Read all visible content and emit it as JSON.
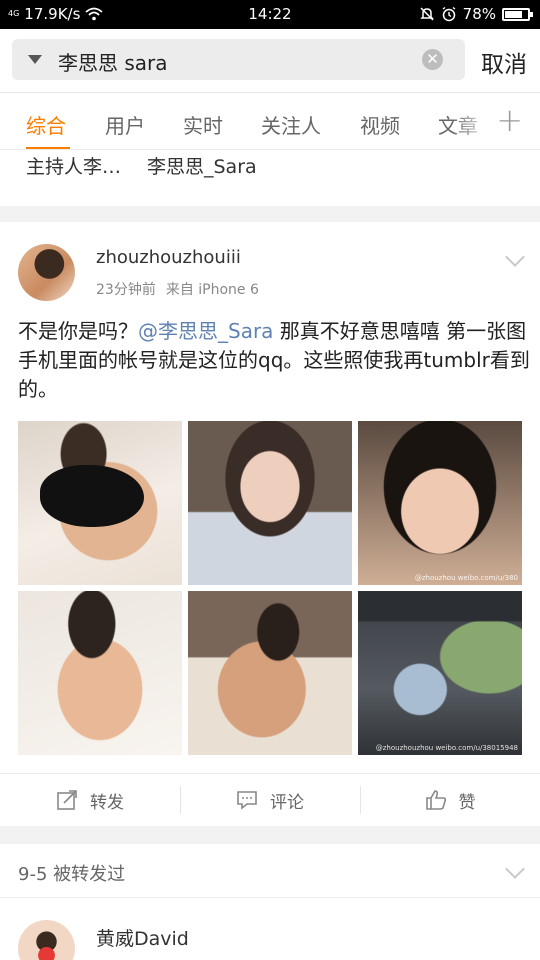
{
  "status_bar": {
    "network": "4G",
    "speed": "17.9K/s",
    "time": "14:22",
    "battery": "78%",
    "battery_level": 0.78
  },
  "search": {
    "query": "李思思 sara",
    "cancel_label": "取消"
  },
  "tabs": [
    {
      "label": "综合",
      "active": true
    },
    {
      "label": "用户"
    },
    {
      "label": "实时"
    },
    {
      "label": "关注人"
    },
    {
      "label": "视频"
    },
    {
      "label": "文章"
    }
  ],
  "user_suggestions": [
    "主持人李…",
    "李思思_Sara"
  ],
  "post": {
    "author": "zhouzhouzhouiii",
    "time": "23分钟前",
    "source": "来自 iPhone 6",
    "text_before": "不是你是吗？",
    "mention": "@李思思_Sara",
    "text_after": " 那真不好意思嘻嘻 第一张图手机里面的帐号就是这位的qq。这些照使我再tumblr看到的。",
    "photo_watermarks": [
      "",
      "",
      "@zhouzhou weibo.com/u/380",
      "",
      "",
      "@zhouzhouzhou weibo.com/u/38015948"
    ],
    "actions": {
      "repost": "转发",
      "comment": "评论",
      "like": "赞"
    }
  },
  "repost_section": {
    "label": "9-5 被转发过",
    "next_author": "黄威David"
  }
}
